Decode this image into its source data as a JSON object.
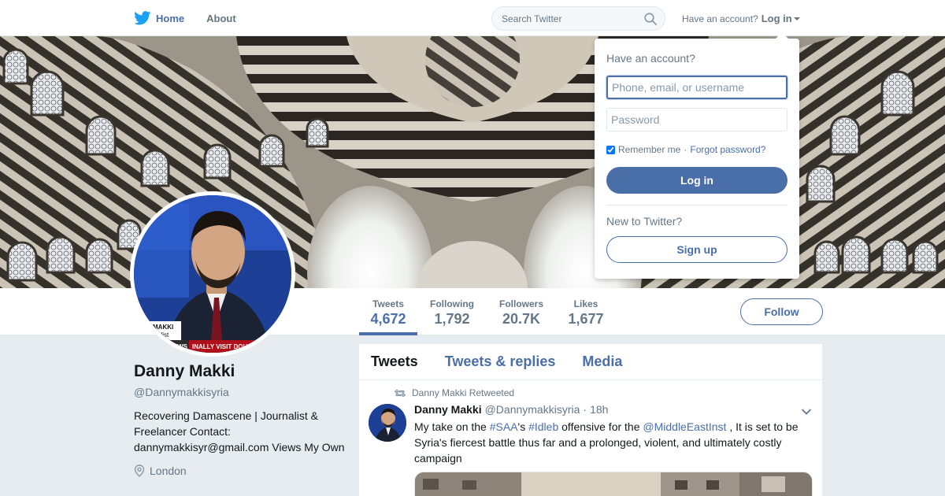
{
  "nav": {
    "home_label": "Home",
    "about_label": "About",
    "search_placeholder": "Search Twitter",
    "have_account": "Have an account?",
    "login_label": "Log in"
  },
  "profile": {
    "name": "Danny Makki",
    "handle": "@Dannymakkisyria",
    "bio": "Recovering Damascene | Journalist & Freelancer Contact: dannymakkisyr@gmail.com Views My Own",
    "location": "London"
  },
  "stats": [
    {
      "label": "Tweets",
      "value": "4,672"
    },
    {
      "label": "Following",
      "value": "1,792"
    },
    {
      "label": "Followers",
      "value": "20.7K"
    },
    {
      "label": "Likes",
      "value": "1,677"
    }
  ],
  "follow_label": "Follow",
  "timeline": {
    "tabs": [
      "Tweets",
      "Tweets & replies",
      "Media"
    ],
    "tweet": {
      "retweet_note": "Danny Makki Retweeted",
      "name": "Danny Makki",
      "handle": "@Dannymakkisyria",
      "dot": "·",
      "time": "18h",
      "text_parts": [
        "My take on the ",
        "#SAA",
        "'s ",
        "#Idleb",
        " offensive for the ",
        "@MiddleEastInst",
        " , It is set to be Syria's fiercest battle thus far and a prolonged, violent, and ultimately costly campaign"
      ]
    }
  },
  "avatar_caption": {
    "line1": "MAKKI",
    "line2": "alist",
    "ticker_left": "NEWS",
    "ticker_right": "INALLY VISIT DOUMA"
  },
  "login_dropdown": {
    "title": "Have an account?",
    "username_placeholder": "Phone, email, or username",
    "password_placeholder": "Password",
    "remember_label": "Remember me",
    "separator": "·",
    "forgot_label": "Forgot password?",
    "login_button": "Log in",
    "new_label": "New to Twitter?",
    "signup_button": "Sign up"
  },
  "colors": {
    "accent": "#4a6ea8",
    "background": "#e6ecf0",
    "text_secondary": "#657786"
  },
  "icons": {
    "logo": "twitter-bird-icon",
    "search": "search-icon",
    "retweet": "retweet-icon",
    "location": "location-pin-icon",
    "menu": "chevron-down-icon"
  }
}
